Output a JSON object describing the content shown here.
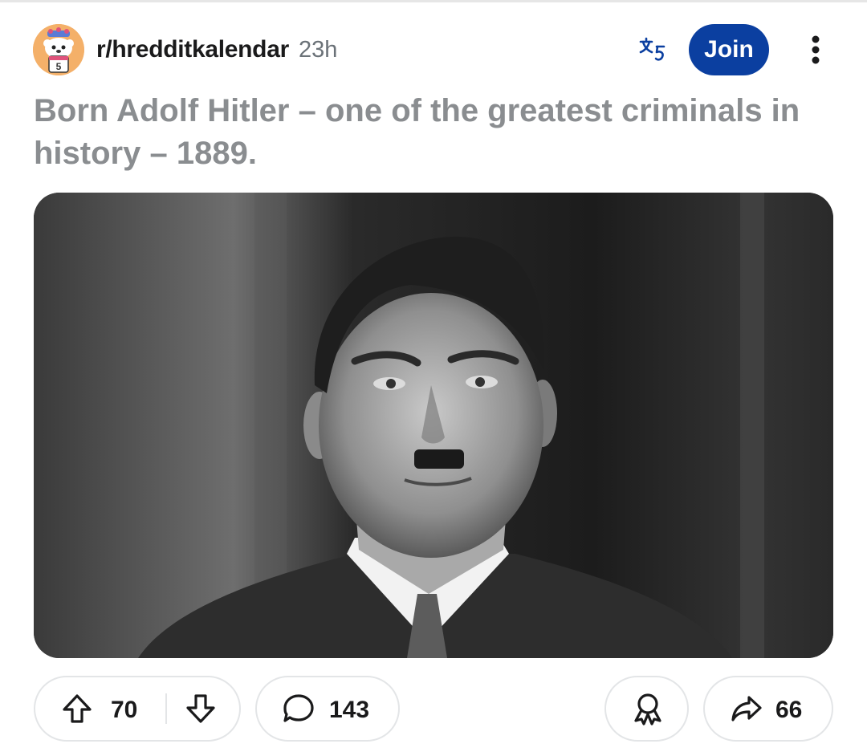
{
  "post": {
    "subreddit": "r/hredditkalendar",
    "time": "23h",
    "join_label": "Join",
    "title": "Born Adolf Hitler – one of the greatest criminals in history – 1889.",
    "avatar_text": "5"
  },
  "actions": {
    "upvotes": "70",
    "comments": "143",
    "shares": "66"
  },
  "icons": {
    "translate": "translate-icon",
    "more": "more-vertical-icon",
    "upvote": "upvote-arrow-icon",
    "downvote": "downvote-arrow-icon",
    "comment": "comment-bubble-icon",
    "award": "award-icon",
    "share": "share-arrow-icon"
  },
  "colors": {
    "join_button": "#0b3fa0",
    "title_text": "#8a8d90",
    "avatar_bg": "#f4b069"
  }
}
